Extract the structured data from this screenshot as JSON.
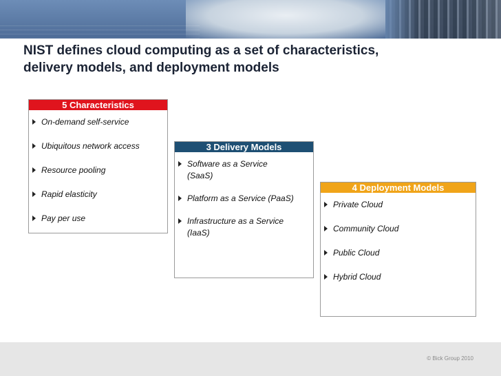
{
  "slide": {
    "title_line1": "NIST defines cloud computing as a set of characteristics,",
    "title_line2": "delivery models, and deployment models"
  },
  "characteristics": {
    "header": "5 Characteristics",
    "items": [
      "On-demand self-service",
      "Ubiquitous network access",
      "Resource pooling",
      "Rapid elasticity",
      "Pay per use"
    ]
  },
  "delivery_models": {
    "header": "3 Delivery Models",
    "items": [
      [
        "Software as a Service",
        "(SaaS)"
      ],
      [
        "Platform as a Service (PaaS)"
      ],
      [
        "Infrastructure as a Service",
        "(IaaS)"
      ]
    ]
  },
  "deployment_models": {
    "header": "4 Deployment Models",
    "items": [
      "Private Cloud",
      "Community Cloud",
      "Public Cloud",
      "Hybrid Cloud"
    ]
  },
  "footer": {
    "copyright": "© Bick Group 2010"
  },
  "colors": {
    "characteristics_header": "#e0141d",
    "delivery_header": "#1e4f73",
    "deployment_header": "#f0a419",
    "banner": "#5a7aa6",
    "title": "#1b2334"
  },
  "icons": {
    "bullet": "triangle-right"
  }
}
